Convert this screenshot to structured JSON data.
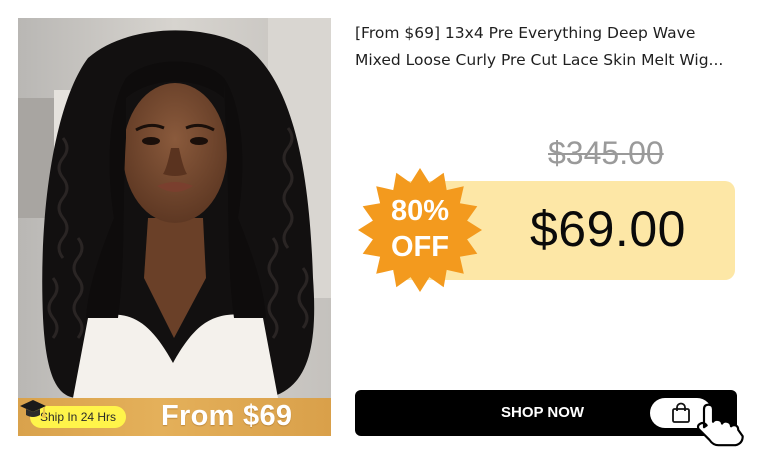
{
  "product": {
    "title_line1": "[From $69] 13x4 Pre Everything Deep Wave",
    "title_line2": "Mixed Loose Curly Pre Cut Lace Skin Melt Wig..."
  },
  "pricing": {
    "original_price": "$345.00",
    "sale_price": "$69.00",
    "discount_percent": "80%",
    "discount_word": "OFF"
  },
  "image_banner": {
    "ship_badge": "Ship In 24 Hrs",
    "promo_text": "From $69"
  },
  "cta": {
    "label": "SHOP NOW"
  },
  "colors": {
    "price_panel": "#fde7a6",
    "starburst": "#f39a1e",
    "button": "#000000",
    "promo_strip": "#dca64f",
    "ship_badge": "#fff44a"
  },
  "icons": [
    "graduation-cap-icon",
    "shopping-bag-icon",
    "pointing-hand-cursor-icon",
    "discount-starburst-icon"
  ]
}
